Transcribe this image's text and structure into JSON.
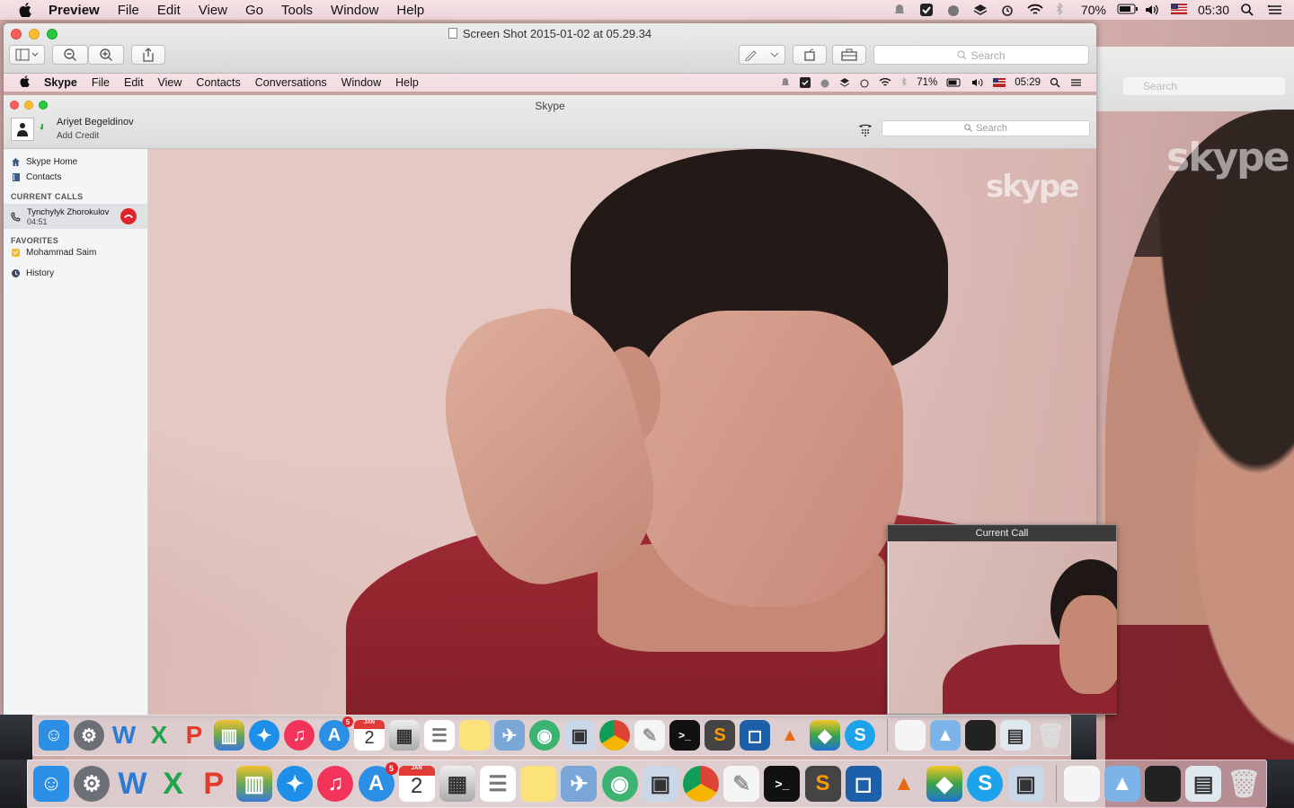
{
  "menubar": {
    "app": "Preview",
    "items": [
      "File",
      "Edit",
      "View",
      "Go",
      "Tools",
      "Window",
      "Help"
    ],
    "battery": "70%",
    "clock": "05:30"
  },
  "preview": {
    "title": "Screen Shot 2015-01-02 at 05.29.34",
    "search_placeholder": "Search"
  },
  "inner_menubar": {
    "app": "Skype",
    "items": [
      "File",
      "Edit",
      "View",
      "Contacts",
      "Conversations",
      "Window",
      "Help"
    ],
    "battery": "71%",
    "clock": "05:29"
  },
  "skype": {
    "title": "Skype",
    "user_name": "Ariyet Begeldinov",
    "add_credit": "Add Credit",
    "search_placeholder": "Search",
    "sidebar": {
      "home": "Skype Home",
      "contacts": "Contacts",
      "current_calls_header": "CURRENT CALLS",
      "call_name": "Tynchylyk Zhorokulov",
      "call_time": "04:51",
      "favorites_header": "FAVORITES",
      "favorite_name": "Mohammad Saim",
      "history": "History"
    },
    "logo": "skype"
  },
  "call_panel": {
    "title": "Current Call"
  },
  "backdrop": {
    "search_placeholder": "Search",
    "logo": "skype"
  },
  "dock": {
    "app_store_badge": "5",
    "calendar_month": "JAN",
    "calendar_day": "2"
  },
  "colors": {
    "menubar_bg": "#f4e0e4",
    "shirt": "#9e2a34",
    "hangup": "#e0242c"
  }
}
